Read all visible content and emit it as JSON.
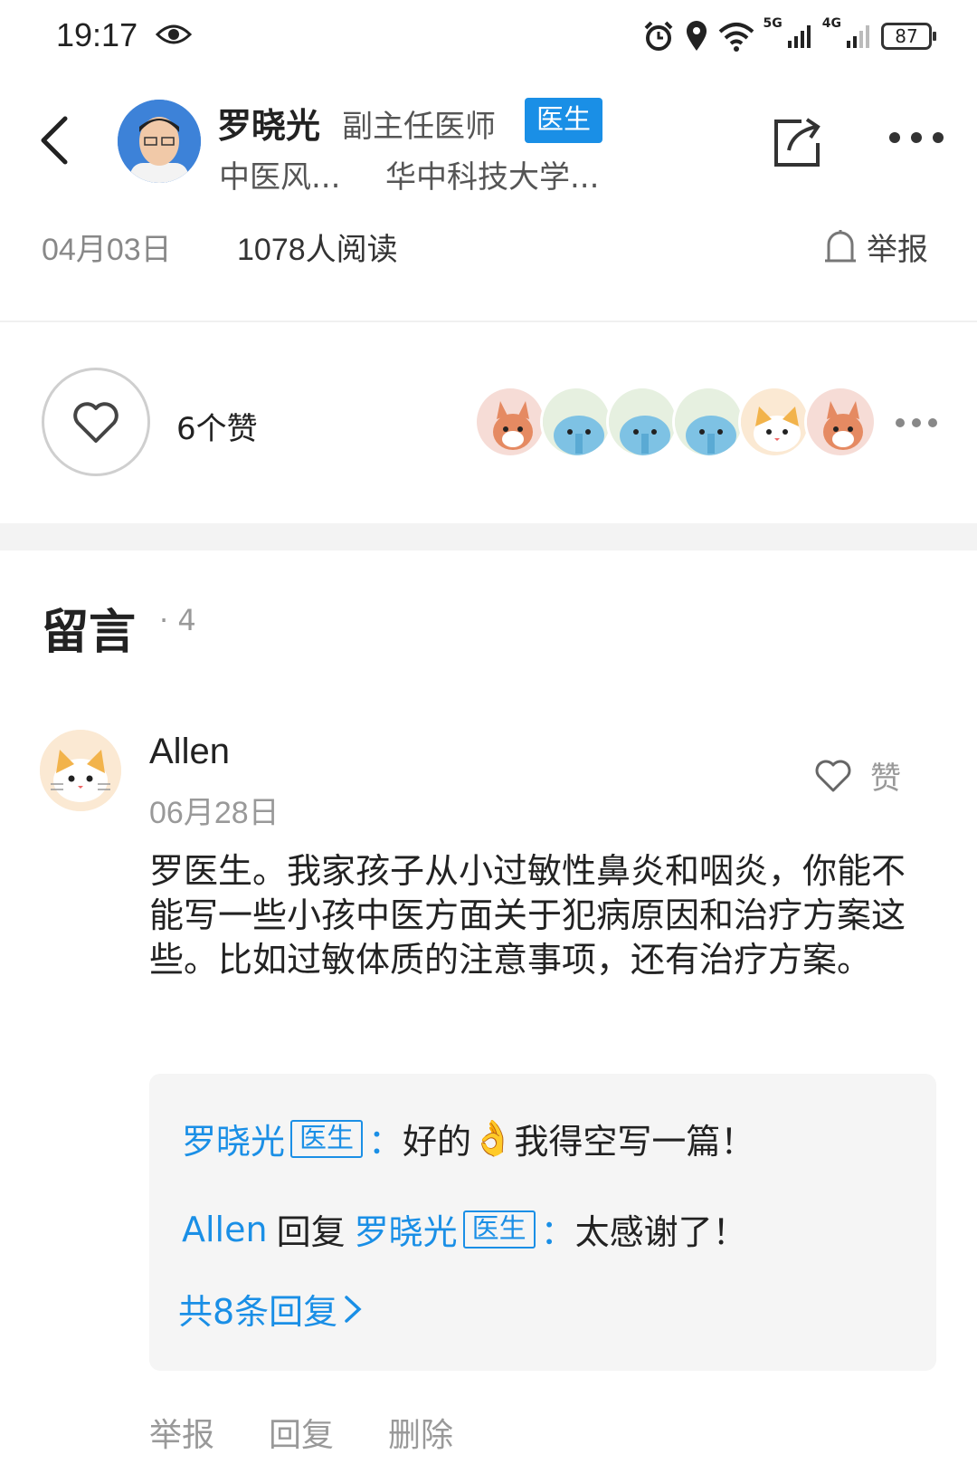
{
  "status_bar": {
    "time": "19:17",
    "network_1": "5G",
    "network_2": "4G",
    "battery": "87"
  },
  "header": {
    "author_name": "罗晓光",
    "author_title": "副主任医师",
    "badge": "医生",
    "department": "中医风...",
    "hospital": "华中科技大学...",
    "date": "04月03日",
    "reads": "1078人阅读",
    "report": "举报"
  },
  "likes": {
    "count_label": "6个赞",
    "likers": [
      "squirrel",
      "elephant",
      "elephant",
      "elephant",
      "cat",
      "squirrel"
    ]
  },
  "comments_section": {
    "title": "留言",
    "count": "· 4"
  },
  "comment": {
    "author": "Allen",
    "date": "06月28日",
    "like_label": "赞",
    "body": "罗医生。我家孩子从小过敏性鼻炎和咽炎，你能不能写一些小孩中医方面关于犯病原因和治疗方案这些。比如过敏体质的注意事项，还有治疗方案。",
    "replies": {
      "r1_author": "罗晓光",
      "r1_tag": "医生",
      "r1_sep": "：",
      "r1_text_a": "好的",
      "r1_emoji": "👌",
      "r1_text_b": "我得空写一篇！",
      "r2_author": "Allen",
      "r2_verb": "回复",
      "r2_target": "罗晓光",
      "r2_tag": "医生",
      "r2_sep": "：",
      "r2_text": "太感谢了！",
      "more": "共8条回复"
    },
    "actions": {
      "report": "举报",
      "reply": "回复",
      "delete": "删除"
    }
  }
}
